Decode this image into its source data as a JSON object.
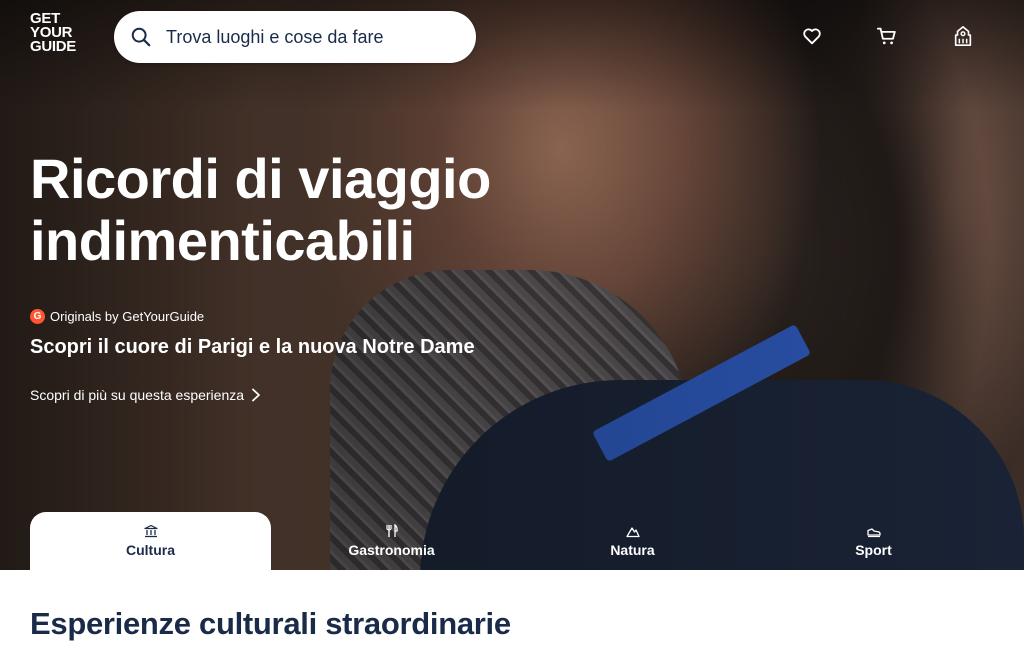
{
  "header": {
    "logo_lines": [
      "GET",
      "YOUR",
      "GUIDE"
    ],
    "search_placeholder": "Trova luoghi e cose da fare",
    "icons": [
      "wishlist-heart-icon",
      "cart-icon",
      "profile-icon"
    ]
  },
  "hero": {
    "headline": "Ricordi di viaggio indimenticabili",
    "badge_letter": "G",
    "originals_label": "Originals by GetYourGuide",
    "subtitle": "Scopri il cuore di Parigi e la nuova Notre Dame",
    "learn_more": "Scopri di più su questa esperienza"
  },
  "tabs": [
    {
      "label": "Cultura",
      "icon": "museum-icon",
      "active": true
    },
    {
      "label": "Gastronomia",
      "icon": "cutlery-icon",
      "active": false
    },
    {
      "label": "Natura",
      "icon": "mountain-icon",
      "active": false
    },
    {
      "label": "Sport",
      "icon": "sneaker-icon",
      "active": false
    }
  ],
  "section": {
    "title": "Esperienze culturali straordinarie"
  },
  "colors": {
    "navy": "#1a2b49",
    "badge": "#ff5533",
    "white": "#ffffff"
  }
}
